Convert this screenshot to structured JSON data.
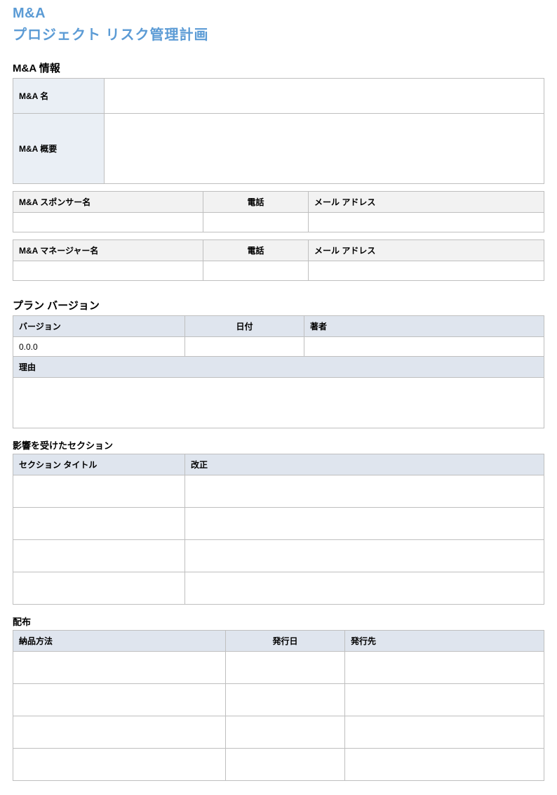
{
  "title": {
    "line1": "M&A",
    "line2": "プロジェクト リスク管理計画"
  },
  "info_section": {
    "heading": "M&A 情報",
    "name_label": "M&A 名",
    "name_value": "",
    "overview_label": "M&A 概要",
    "overview_value": ""
  },
  "sponsor_table": {
    "headers": {
      "name": "M&A スポンサー名",
      "phone": "電話",
      "email": "メール アドレス"
    },
    "row": {
      "name": "",
      "phone": "",
      "email": ""
    }
  },
  "manager_table": {
    "headers": {
      "name": "M&A マネージャー名",
      "phone": "電話",
      "email": "メール アドレス"
    },
    "row": {
      "name": "",
      "phone": "",
      "email": ""
    }
  },
  "version_section": {
    "heading": "プラン バージョン",
    "headers": {
      "version": "バージョン",
      "date": "日付",
      "author": "著者"
    },
    "row": {
      "version": "0.0.0",
      "date": "",
      "author": ""
    },
    "reason_label": "理由",
    "reason_value": ""
  },
  "affected_section": {
    "heading": "影響を受けたセクション",
    "headers": {
      "title": "セクション タイトル",
      "revision": "改正"
    },
    "rows": [
      {
        "title": "",
        "revision": ""
      },
      {
        "title": "",
        "revision": ""
      },
      {
        "title": "",
        "revision": ""
      },
      {
        "title": "",
        "revision": ""
      }
    ]
  },
  "distribution_section": {
    "heading": "配布",
    "headers": {
      "method": "納品方法",
      "issue_date": "発行日",
      "issued_to": "発行先"
    },
    "rows": [
      {
        "method": "",
        "issue_date": "",
        "issued_to": ""
      },
      {
        "method": "",
        "issue_date": "",
        "issued_to": ""
      },
      {
        "method": "",
        "issue_date": "",
        "issued_to": ""
      },
      {
        "method": "",
        "issue_date": "",
        "issued_to": ""
      }
    ]
  }
}
